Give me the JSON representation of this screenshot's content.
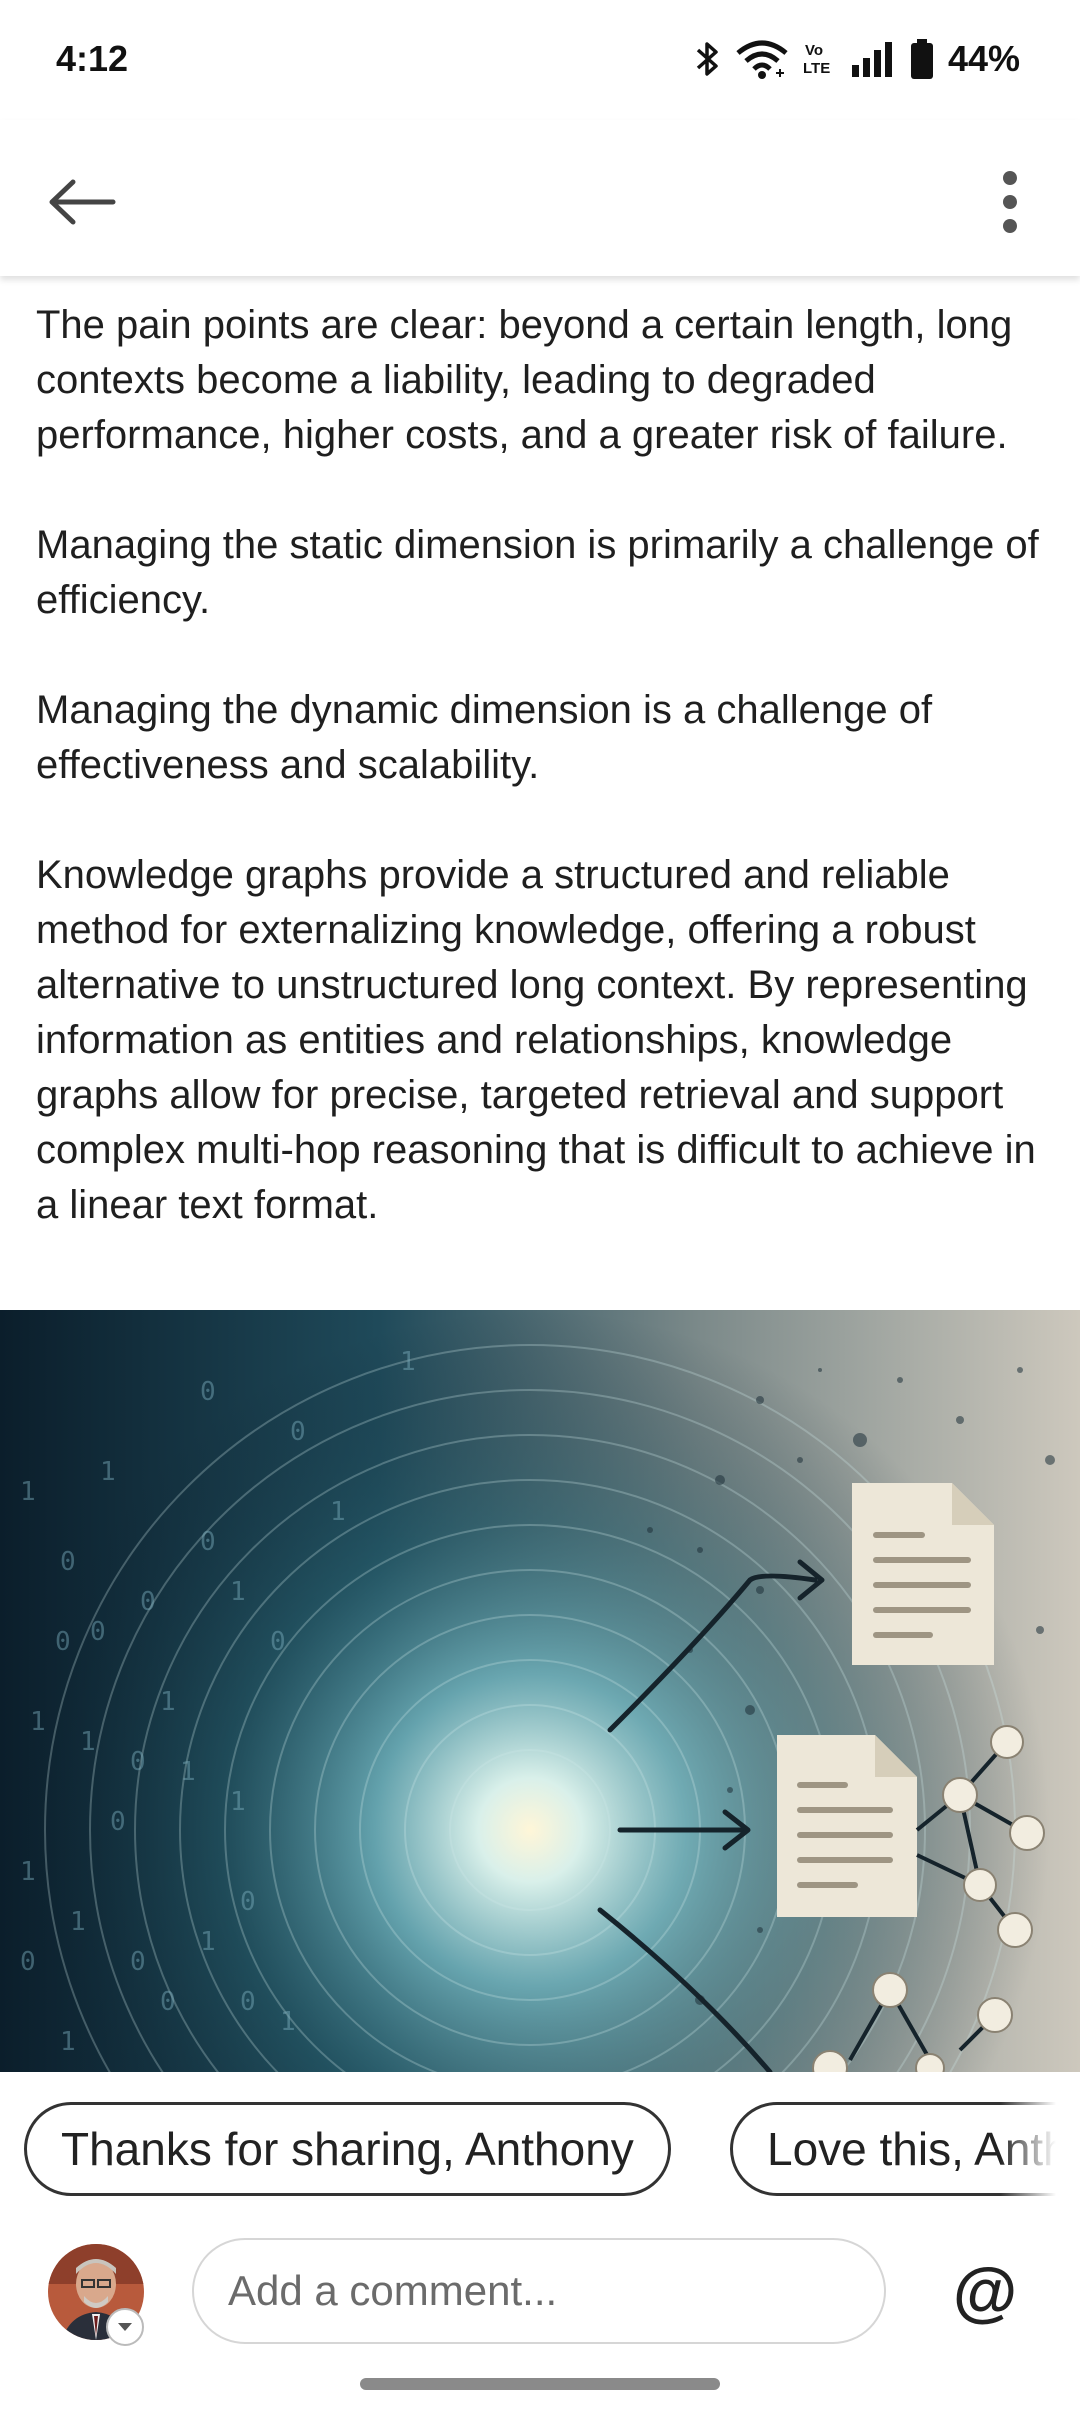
{
  "status_bar": {
    "time": "4:12",
    "battery": "44%",
    "icons": [
      "bluetooth-icon",
      "wifi-icon",
      "volte-icon",
      "signal-icon",
      "battery-icon"
    ]
  },
  "header": {
    "back_icon": "arrow-left-icon",
    "menu_icon": "more-vert-icon"
  },
  "article": {
    "paragraphs": [
      "The pain points are clear: beyond a certain length, long contexts become a liability, leading to degraded performance, higher costs, and a greater risk of failure.",
      "Managing the static dimension is primarily a challenge of efficiency.",
      "Managing the dynamic dimension is a challenge of effectiveness and scalability.",
      "Knowledge graphs provide a structured and reliable method for externalizing knowledge, offering a robust alternative to unstructured long context. By representing information as entities and relationships, knowledge graphs allow for precise, targeted retrieval and support complex multi-hop reasoning that is difficult to achieve in a linear text format."
    ]
  },
  "suggestions": [
    "Thanks for sharing, Anthony",
    "Love this, Anthony"
  ],
  "comment": {
    "placeholder": "Add a comment...",
    "mention_symbol": "@"
  },
  "colors": {
    "hero_dark": "#0d2230",
    "hero_glow": "#fff6d8",
    "hero_light": "#c9c5bb"
  }
}
